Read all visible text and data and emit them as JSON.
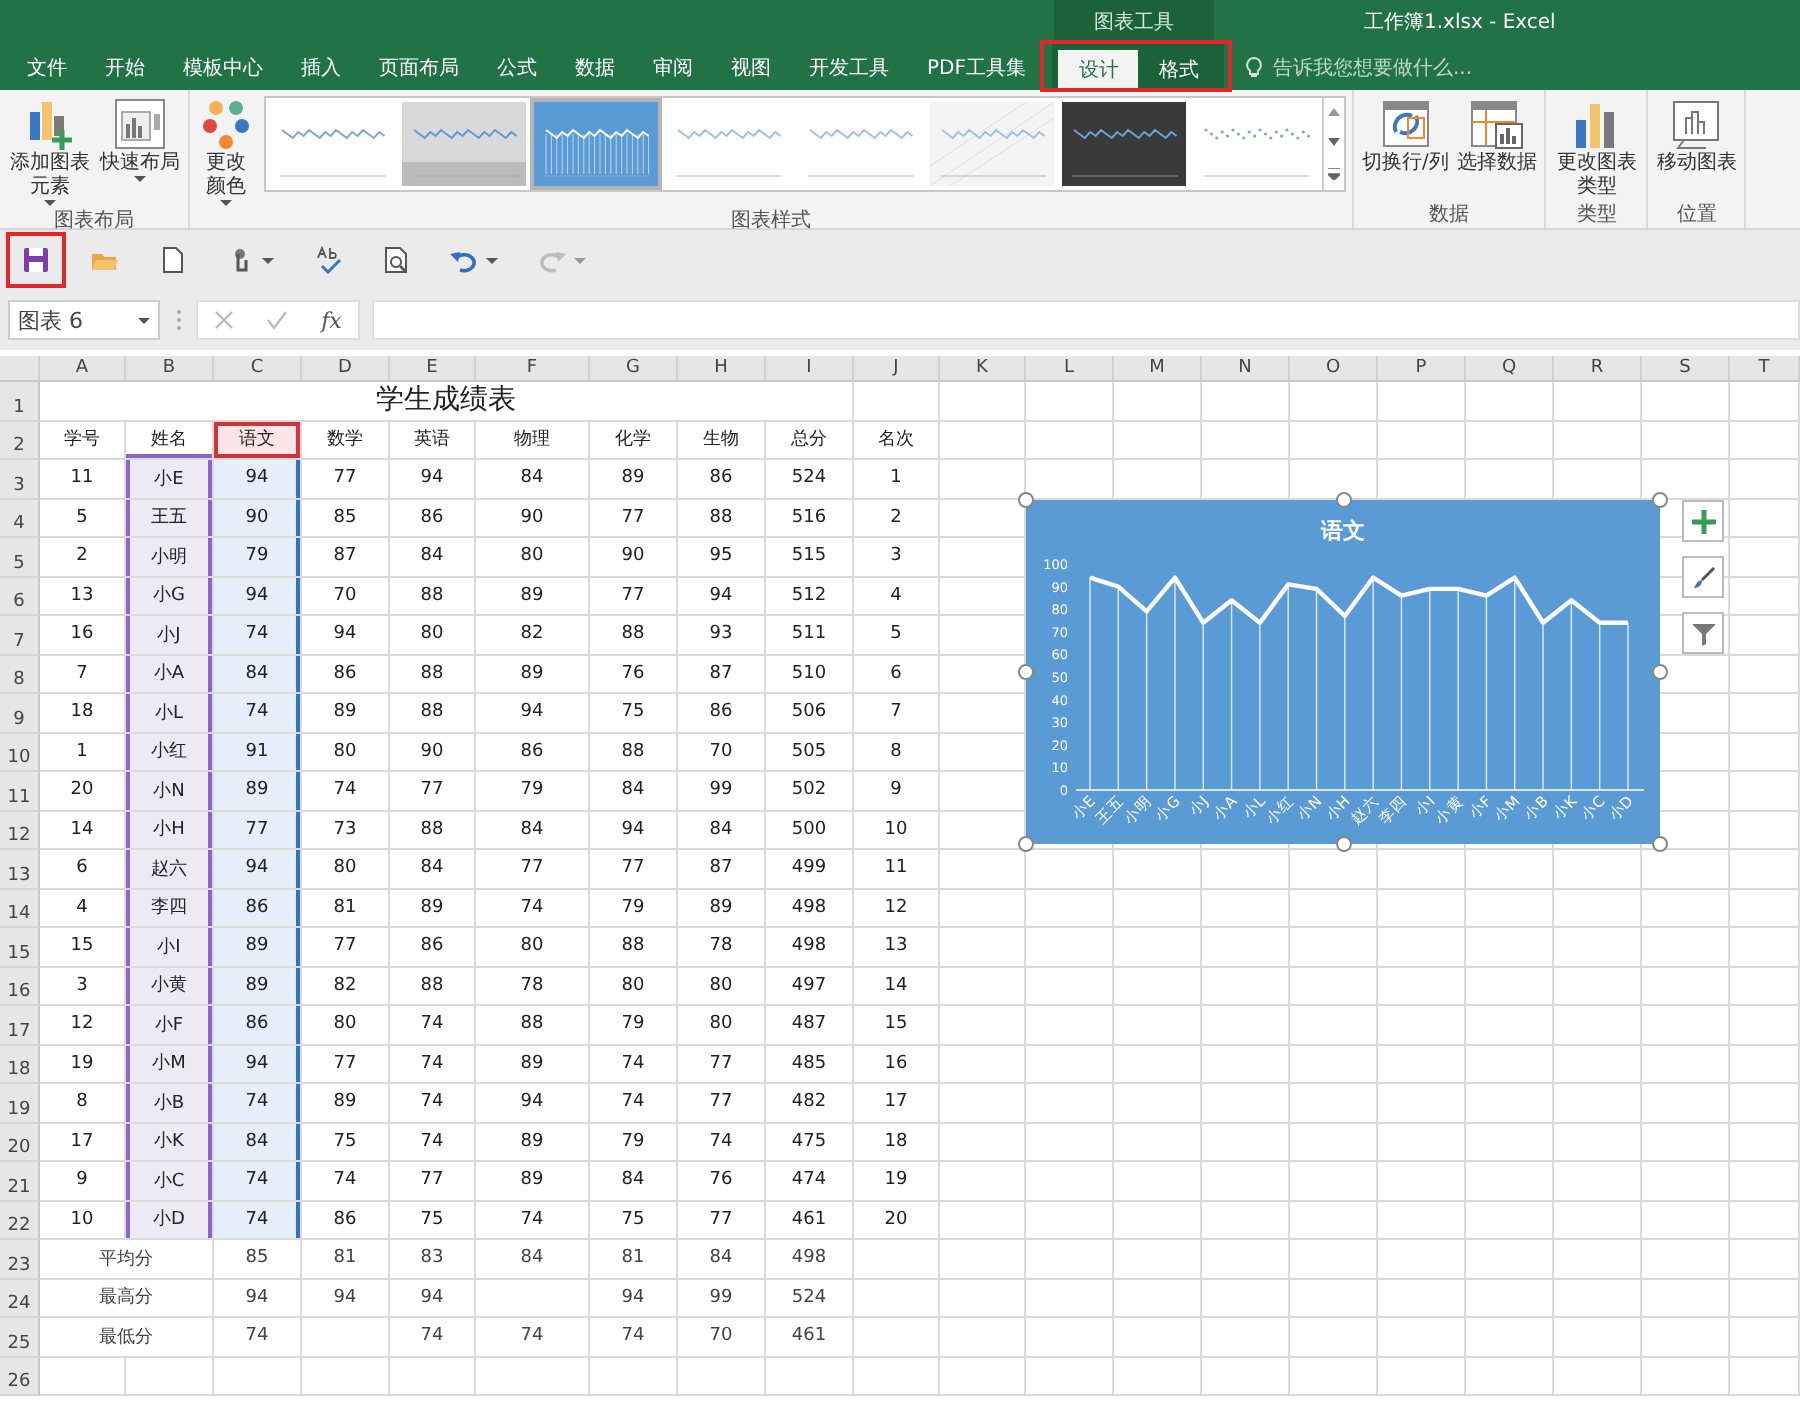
{
  "title_bar": {
    "title": "工作簿1.xlsx - Excel",
    "context_label": "图表工具",
    "context_callout": true
  },
  "tabs": [
    {
      "label": "文件",
      "selected": false,
      "context": false
    },
    {
      "label": "开始",
      "selected": false,
      "context": false
    },
    {
      "label": "模板中心",
      "selected": false,
      "context": false
    },
    {
      "label": "插入",
      "selected": false,
      "context": false
    },
    {
      "label": "页面布局",
      "selected": false,
      "context": false
    },
    {
      "label": "公式",
      "selected": false,
      "context": false
    },
    {
      "label": "数据",
      "selected": false,
      "context": false
    },
    {
      "label": "审阅",
      "selected": false,
      "context": false
    },
    {
      "label": "视图",
      "selected": false,
      "context": false
    },
    {
      "label": "开发工具",
      "selected": false,
      "context": false
    },
    {
      "label": "PDF工具集",
      "selected": false,
      "context": false
    },
    {
      "label": "设计",
      "selected": true,
      "context": true
    },
    {
      "label": "格式",
      "selected": false,
      "context": true
    }
  ],
  "tell_me": {
    "placeholder": "告诉我您想要做什么..."
  },
  "ribbon": {
    "groups": [
      {
        "label": "图表布局",
        "items": [
          {
            "kind": "button",
            "label": "添加图表元素",
            "dropdown": true
          },
          {
            "kind": "button",
            "label": "快速布局",
            "dropdown": true
          }
        ]
      },
      {
        "label": "图表样式",
        "items": [
          {
            "kind": "button",
            "label": "更改颜色",
            "dropdown": true
          },
          {
            "kind": "gallery",
            "styles": [
              {
                "selected": false
              },
              {
                "selected": false
              },
              {
                "selected": true
              },
              {
                "selected": false
              },
              {
                "selected": false
              },
              {
                "selected": false
              },
              {
                "selected": false
              },
              {
                "selected": false
              }
            ]
          }
        ]
      },
      {
        "label": "数据",
        "items": [
          {
            "kind": "button",
            "label": "切换行/列",
            "dropdown": false
          },
          {
            "kind": "button",
            "label": "选择数据",
            "dropdown": false
          }
        ]
      },
      {
        "label": "类型",
        "items": [
          {
            "kind": "button",
            "label": "更改图表类型",
            "dropdown": false
          }
        ]
      },
      {
        "label": "位置",
        "items": [
          {
            "kind": "button",
            "label": "移动图表",
            "dropdown": false
          }
        ]
      }
    ]
  },
  "quick_access": [
    {
      "kind": "save",
      "callout": true,
      "dropdown": false,
      "disabled": false
    },
    {
      "kind": "open",
      "callout": false,
      "dropdown": false,
      "disabled": false
    },
    {
      "kind": "new",
      "callout": false,
      "dropdown": false,
      "disabled": false
    },
    {
      "kind": "touch",
      "callout": false,
      "dropdown": true,
      "disabled": false
    },
    {
      "kind": "spelling",
      "callout": false,
      "dropdown": false,
      "disabled": false
    },
    {
      "kind": "preview",
      "callout": false,
      "dropdown": false,
      "disabled": false
    },
    {
      "kind": "undo",
      "callout": false,
      "dropdown": true,
      "disabled": false
    },
    {
      "kind": "redo",
      "callout": false,
      "dropdown": true,
      "disabled": true
    }
  ],
  "formula_bar": {
    "name_box": "图表 6",
    "function_button": "fx"
  },
  "sheet": {
    "columns": [
      "A",
      "B",
      "C",
      "D",
      "E",
      "F",
      "G",
      "H",
      "I",
      "J",
      "K",
      "L",
      "M",
      "N",
      "O",
      "P",
      "Q",
      "R",
      "S",
      "T"
    ],
    "row_numbers": [
      "1",
      "2",
      "3",
      "4",
      "5",
      "6",
      "7",
      "8",
      "9",
      "10",
      "11",
      "12",
      "13",
      "14",
      "15",
      "16",
      "17",
      "18",
      "19",
      "20",
      "21",
      "22",
      "23",
      "24",
      "25",
      "26"
    ],
    "title": "学生成绩表",
    "headers": [
      {
        "text": "学号"
      },
      {
        "text": "姓名",
        "category_range": true
      },
      {
        "text": "语文",
        "series_range": true
      },
      {
        "text": "数学"
      },
      {
        "text": "英语"
      },
      {
        "text": "物理"
      },
      {
        "text": "化学"
      },
      {
        "text": "生物"
      },
      {
        "text": "总分"
      },
      {
        "text": "名次"
      }
    ],
    "rows": [
      [
        "11",
        "小E",
        "94",
        "77",
        "94",
        "84",
        "89",
        "86",
        "524",
        "1"
      ],
      [
        "5",
        "王五",
        "90",
        "85",
        "86",
        "90",
        "77",
        "88",
        "516",
        "2"
      ],
      [
        "2",
        "小明",
        "79",
        "87",
        "84",
        "80",
        "90",
        "95",
        "515",
        "3"
      ],
      [
        "13",
        "小G",
        "94",
        "70",
        "88",
        "89",
        "77",
        "94",
        "512",
        "4"
      ],
      [
        "16",
        "小J",
        "74",
        "94",
        "80",
        "82",
        "88",
        "93",
        "511",
        "5"
      ],
      [
        "7",
        "小A",
        "84",
        "86",
        "88",
        "89",
        "76",
        "87",
        "510",
        "6"
      ],
      [
        "18",
        "小L",
        "74",
        "89",
        "88",
        "94",
        "75",
        "86",
        "506",
        "7"
      ],
      [
        "1",
        "小红",
        "91",
        "80",
        "90",
        "86",
        "88",
        "70",
        "505",
        "8"
      ],
      [
        "20",
        "小N",
        "89",
        "74",
        "77",
        "79",
        "84",
        "99",
        "502",
        "9"
      ],
      [
        "14",
        "小H",
        "77",
        "73",
        "88",
        "84",
        "94",
        "84",
        "500",
        "10"
      ],
      [
        "6",
        "赵六",
        "94",
        "80",
        "84",
        "77",
        "77",
        "87",
        "499",
        "11"
      ],
      [
        "4",
        "李四",
        "86",
        "81",
        "89",
        "74",
        "79",
        "89",
        "498",
        "12"
      ],
      [
        "15",
        "小I",
        "89",
        "77",
        "86",
        "80",
        "88",
        "78",
        "498",
        "13"
      ],
      [
        "3",
        "小黄",
        "89",
        "82",
        "88",
        "78",
        "80",
        "80",
        "497",
        "14"
      ],
      [
        "12",
        "小F",
        "86",
        "80",
        "74",
        "88",
        "79",
        "80",
        "487",
        "15"
      ],
      [
        "19",
        "小M",
        "94",
        "77",
        "74",
        "89",
        "74",
        "77",
        "485",
        "16"
      ],
      [
        "8",
        "小B",
        "74",
        "89",
        "74",
        "94",
        "74",
        "77",
        "482",
        "17"
      ],
      [
        "17",
        "小K",
        "84",
        "75",
        "74",
        "89",
        "79",
        "74",
        "475",
        "18"
      ],
      [
        "9",
        "小C",
        "74",
        "74",
        "77",
        "89",
        "84",
        "76",
        "474",
        "19"
      ],
      [
        "10",
        "小D",
        "74",
        "86",
        "75",
        "74",
        "75",
        "77",
        "461",
        "20"
      ]
    ],
    "summary": [
      {
        "label": "平均分",
        "cells": [
          "85",
          "81",
          "83",
          "84",
          "81",
          "84",
          "498"
        ]
      },
      {
        "label": "最高分",
        "cells": [
          "94",
          "94",
          "94",
          null,
          "94",
          "99",
          "524"
        ]
      },
      {
        "label": "最低分",
        "cells": [
          "74",
          null,
          "74",
          "74",
          "74",
          "70",
          "461"
        ]
      }
    ]
  },
  "chart": {
    "selected": true,
    "chart_data": {
      "type": "line",
      "title": "语文",
      "categories": [
        "小E",
        "王五",
        "小明",
        "小G",
        "小J",
        "小A",
        "小L",
        "小红",
        "小N",
        "小H",
        "赵六",
        "李四",
        "小I",
        "小黄",
        "小F",
        "小M",
        "小B",
        "小K",
        "小C",
        "小D"
      ],
      "grid": true,
      "series": [
        {
          "color": "#ffffff",
          "values": [
            94,
            90,
            79,
            94,
            74,
            84,
            74,
            91,
            89,
            77,
            94,
            86,
            89,
            89,
            86,
            94,
            74,
            84,
            74,
            74
          ]
        }
      ],
      "ylim": [
        0,
        100
      ],
      "yticks": [
        0,
        10,
        20,
        30,
        40,
        50,
        60,
        70,
        80,
        90,
        100
      ]
    },
    "tools": [
      {
        "kind": "elements"
      },
      {
        "kind": "styles"
      },
      {
        "kind": "filter"
      }
    ]
  }
}
